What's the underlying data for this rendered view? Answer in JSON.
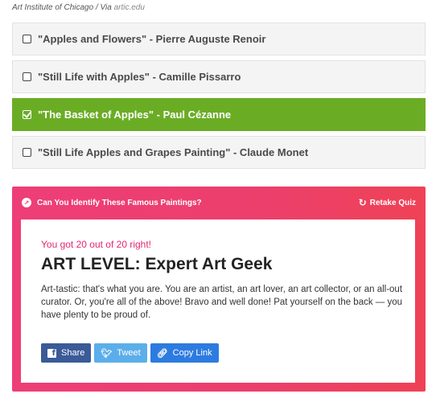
{
  "credit": {
    "text": "Art Institute of Chicago / Via ",
    "link": "artic.edu"
  },
  "answers": [
    {
      "label": "\"Apples and Flowers\" - Pierre Auguste Renoir",
      "selected": false
    },
    {
      "label": "\"Still Life with Apples\" - Camille Pissarro",
      "selected": false
    },
    {
      "label": "\"The Basket of Apples\" - Paul Cézanne",
      "selected": true
    },
    {
      "label": "\"Still Life Apples and Grapes Painting\" - Claude Monet",
      "selected": false
    }
  ],
  "result": {
    "quiz_title": "Can You Identify These Famous Paintings?",
    "retake_label": "Retake Quiz",
    "score_text": "You got 20 out of 20 right!",
    "level_title": "ART LEVEL: Expert Art Geek",
    "description": "Art-tastic: that's what you are. You are an artist, an art lover, an art collector, or an all-out curator. Or, you're all of the above! Bravo and well done! Pat yourself on the back — you have plenty to be proud of.",
    "share": {
      "facebook": "Share",
      "twitter": "Tweet",
      "copy_link": "Copy Link"
    }
  },
  "colors": {
    "selected_answer": "#6aad25",
    "result_gradient_start": "#ee3e78",
    "result_gradient_end": "#ef4256",
    "score_text": "#e8246f",
    "facebook": "#3b5a98",
    "twitter": "#5baeea",
    "copy_link": "#2d7be0"
  }
}
